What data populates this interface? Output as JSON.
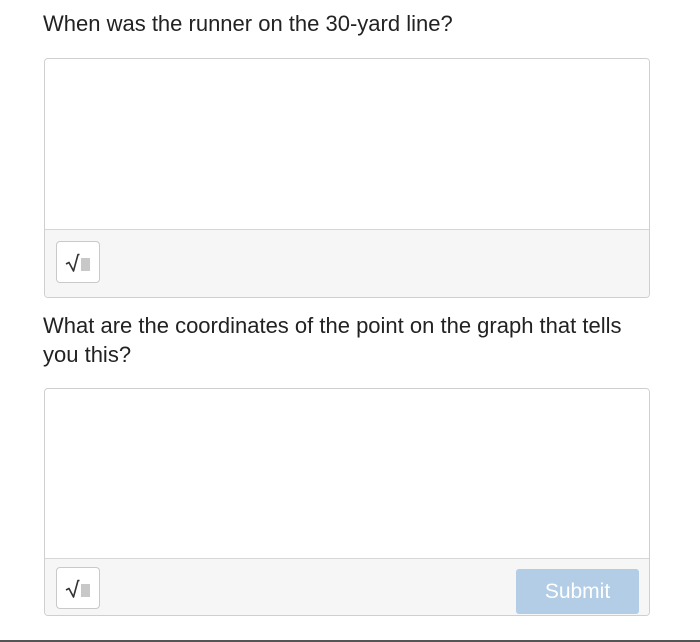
{
  "questions": [
    {
      "prompt": "When was the runner on the 30-yard line?",
      "answer_value": "",
      "math_button_icon": "square-root-icon"
    },
    {
      "prompt": "What are the coordinates of the point on the graph that tells you this?",
      "answer_value": "",
      "math_button_icon": "square-root-icon"
    }
  ],
  "submit": {
    "label": "Submit",
    "background": "#b3cde6",
    "text_color": "#ffffff"
  }
}
